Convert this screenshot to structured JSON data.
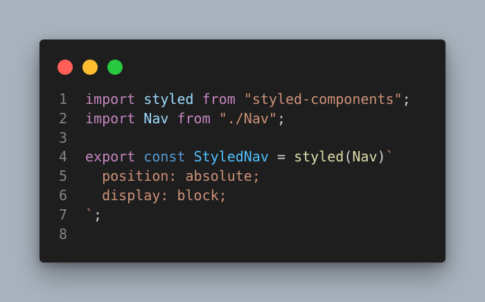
{
  "colors": {
    "background": "#a9b3be",
    "window": "#1e1e1e",
    "close": "#ff5f57",
    "minimize": "#febc2e",
    "maximize": "#28c840"
  },
  "window_controls": [
    {
      "name": "close-dot",
      "color": "#ff5f57"
    },
    {
      "name": "minimize-dot",
      "color": "#febc2e"
    },
    {
      "name": "maximize-dot",
      "color": "#28c840"
    }
  ],
  "code": {
    "lines": [
      {
        "number": "1",
        "tokens": [
          {
            "text": "import",
            "type": "keyword"
          },
          {
            "text": " ",
            "type": "punct"
          },
          {
            "text": "styled",
            "type": "ident"
          },
          {
            "text": " ",
            "type": "punct"
          },
          {
            "text": "from",
            "type": "keyword"
          },
          {
            "text": " ",
            "type": "punct"
          },
          {
            "text": "\"styled-components\"",
            "type": "string"
          },
          {
            "text": ";",
            "type": "punct"
          }
        ]
      },
      {
        "number": "2",
        "tokens": [
          {
            "text": "import",
            "type": "keyword"
          },
          {
            "text": " ",
            "type": "punct"
          },
          {
            "text": "Nav",
            "type": "ident"
          },
          {
            "text": " ",
            "type": "punct"
          },
          {
            "text": "from",
            "type": "keyword"
          },
          {
            "text": " ",
            "type": "punct"
          },
          {
            "text": "\"./Nav\"",
            "type": "string"
          },
          {
            "text": ";",
            "type": "punct"
          }
        ]
      },
      {
        "number": "3",
        "tokens": []
      },
      {
        "number": "4",
        "tokens": [
          {
            "text": "export",
            "type": "keyword"
          },
          {
            "text": " ",
            "type": "punct"
          },
          {
            "text": "const",
            "type": "storage"
          },
          {
            "text": " ",
            "type": "punct"
          },
          {
            "text": "StyledNav",
            "type": "class"
          },
          {
            "text": " = ",
            "type": "punct"
          },
          {
            "text": "styled",
            "type": "func"
          },
          {
            "text": "(",
            "type": "punct"
          },
          {
            "text": "Nav",
            "type": "func"
          },
          {
            "text": ")",
            "type": "punct"
          },
          {
            "text": "`",
            "type": "tick"
          }
        ]
      },
      {
        "number": "5",
        "tokens": [
          {
            "text": "  position: absolute;",
            "type": "prop"
          }
        ]
      },
      {
        "number": "6",
        "tokens": [
          {
            "text": "  display: block;",
            "type": "prop"
          }
        ]
      },
      {
        "number": "7",
        "tokens": [
          {
            "text": "`",
            "type": "tick"
          },
          {
            "text": ";",
            "type": "punct"
          }
        ]
      },
      {
        "number": "8",
        "tokens": []
      }
    ]
  }
}
